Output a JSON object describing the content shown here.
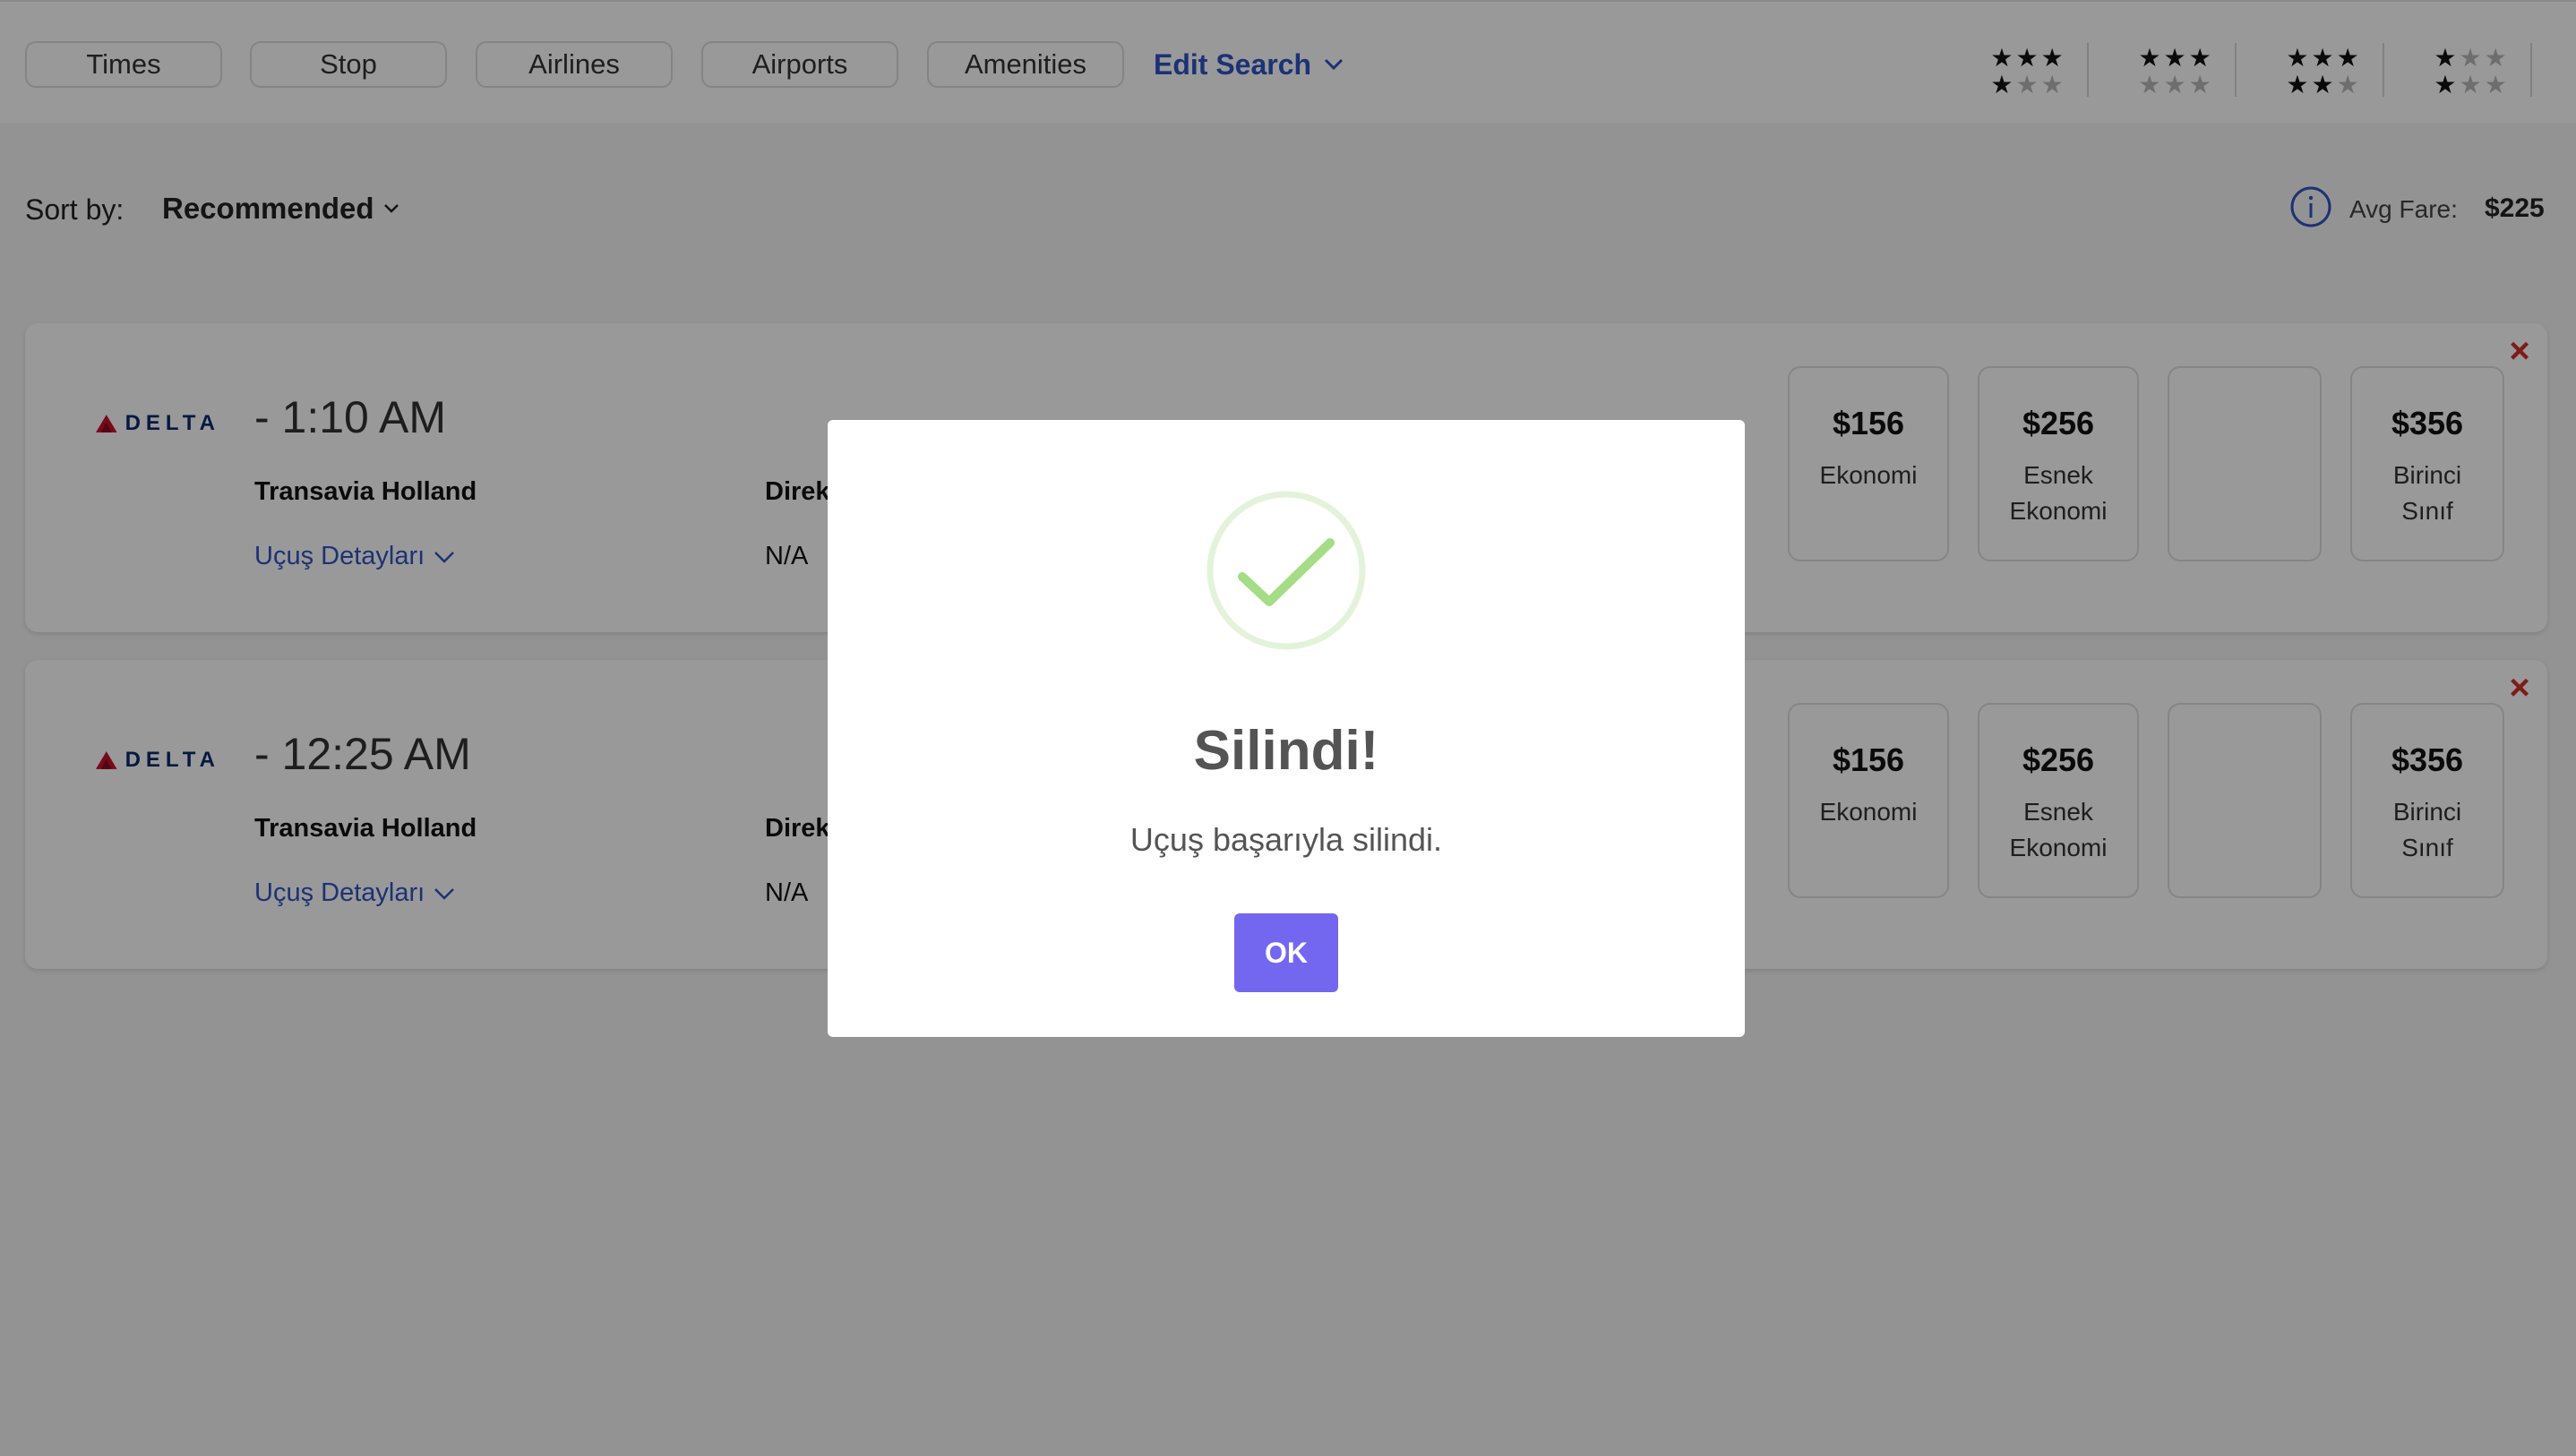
{
  "filters": {
    "pills": [
      "Times",
      "Stop",
      "Airlines",
      "Airports",
      "Amenities"
    ],
    "edit_search": "Edit Search"
  },
  "star_ratings": [
    {
      "top_filled": 3,
      "bottom_filled": 1
    },
    {
      "top_filled": 3,
      "bottom_filled": 0
    },
    {
      "top_filled": 3,
      "bottom_filled": 2
    },
    {
      "top_filled": 1,
      "bottom_filled": 1
    }
  ],
  "sort": {
    "label": "Sort by:",
    "value": "Recommended"
  },
  "avg_fare": {
    "label": "Avg Fare:",
    "value": "$225"
  },
  "flights": [
    {
      "logo_text": "DELTA",
      "time": "- 1:10 AM",
      "airline": "Transavia Holland",
      "details_link": "Uçuş Detayları",
      "direct": "Direk",
      "na": "N/A",
      "fares": [
        {
          "price": "$156",
          "name": "Ekonomi"
        },
        {
          "price": "$256",
          "name": "Esnek Ekonomi"
        },
        {
          "price": "",
          "name": ""
        },
        {
          "price": "$356",
          "name": "Birinci Sınıf"
        }
      ]
    },
    {
      "logo_text": "DELTA",
      "time": "- 12:25 AM",
      "airline": "Transavia Holland",
      "details_link": "Uçuş Detayları",
      "direct": "Direk",
      "na": "N/A",
      "fares": [
        {
          "price": "$156",
          "name": "Ekonomi"
        },
        {
          "price": "$256",
          "name": "Esnek Ekonomi"
        },
        {
          "price": "",
          "name": ""
        },
        {
          "price": "$356",
          "name": "Birinci Sınıf"
        }
      ]
    }
  ],
  "modal": {
    "title": "Silindi!",
    "message": "Uçuş başarıyla silindi.",
    "ok_label": "OK"
  },
  "colors": {
    "accent_blue": "#2f54c4",
    "delete_red": "#d0302a",
    "ok_button": "#7367f0",
    "success_green": "#a5dc86"
  },
  "icons": {
    "chevron": "chevron-down-icon",
    "info": "info-icon",
    "success": "check-circle-icon",
    "close": "close-icon",
    "star": "star-icon",
    "airline_logo": "delta-logo-icon"
  }
}
